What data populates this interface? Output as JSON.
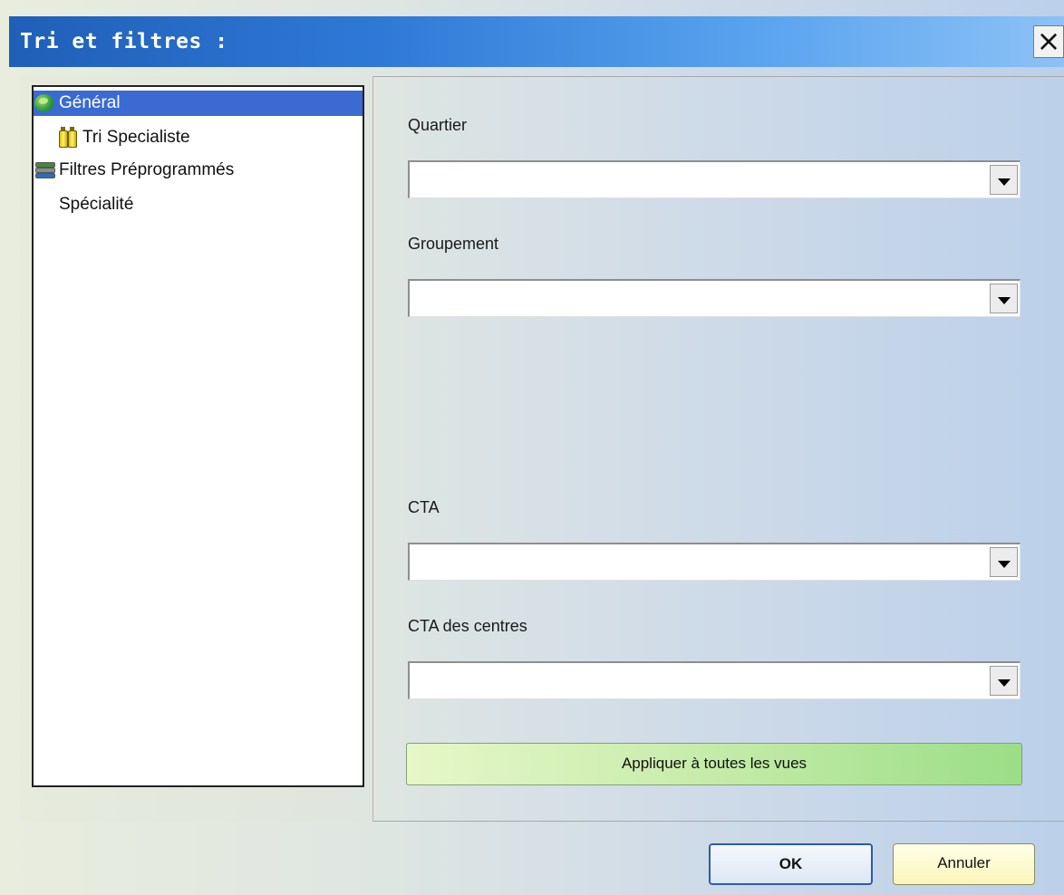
{
  "window": {
    "title": "Tri et filtres :",
    "close_label": "✕"
  },
  "tree": {
    "items": [
      {
        "label": "Général",
        "icon": "globe-icon",
        "selected": true
      },
      {
        "label": "Tri Specialiste",
        "icon": "bottles-icon",
        "selected": false
      },
      {
        "label": "Filtres Préprogrammés",
        "icon": "books-icon",
        "selected": false
      },
      {
        "label": "Spécialité",
        "icon": "",
        "selected": false
      }
    ]
  },
  "filters": {
    "quartier": {
      "label": "Quartier",
      "value": ""
    },
    "groupement": {
      "label": "Groupement",
      "value": ""
    },
    "cta": {
      "label": "CTA",
      "value": ""
    },
    "cta_centres": {
      "label": "CTA des centres",
      "value": ""
    }
  },
  "buttons": {
    "apply_all": "Appliquer à toutes les vues",
    "ok": "OK",
    "cancel": "Annuler"
  },
  "colors": {
    "title_bar": "#2f79d6",
    "selection": "#3a6ad2",
    "apply_button": "#cdeeb0",
    "cancel_button": "#fbf5b8"
  }
}
